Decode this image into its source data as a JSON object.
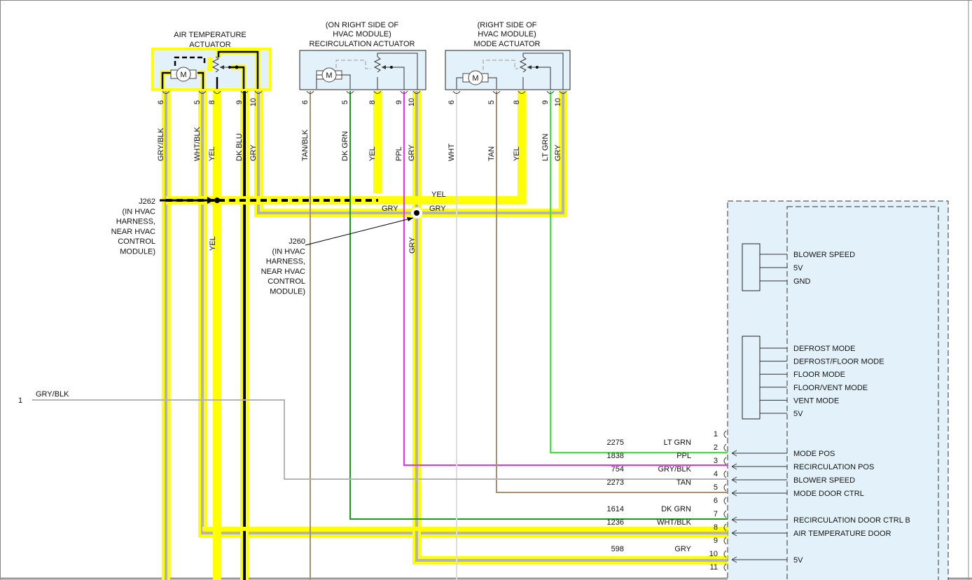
{
  "actuators": {
    "air_temp": {
      "title_1": "AIR TEMPERATURE",
      "title_2": "ACTUATOR",
      "pins": [
        "6",
        "5",
        "8",
        "9",
        "10"
      ],
      "wires": [
        "GRY/BLK",
        "WHT/BLK",
        "YEL",
        "DK BLU",
        "GRY"
      ]
    },
    "recirc": {
      "title_1": "(ON RIGHT SIDE OF",
      "title_2": "HVAC MODULE)",
      "title_3": "RECIRCULATION ACTUATOR",
      "pins": [
        "6",
        "5",
        "8",
        "9",
        "10"
      ],
      "wires": [
        "TAN/BLK",
        "DK GRN",
        "YEL",
        "PPL",
        "GRY"
      ]
    },
    "mode": {
      "title_1": "(RIGHT SIDE OF",
      "title_2": "HVAC MODULE)",
      "title_3": "MODE ACTUATOR",
      "pins": [
        "6",
        "5",
        "8",
        "9",
        "10"
      ],
      "wires": [
        "WHT",
        "TAN",
        "YEL",
        "LT GRN",
        "GRY"
      ]
    },
    "motor_symbol": "M"
  },
  "splices": {
    "j262": {
      "lines": [
        "J262",
        "(IN HVAC",
        "HARNESS,",
        "NEAR HVAC",
        "CONTROL",
        "MODULE)"
      ]
    },
    "j260": {
      "lines": [
        "J260",
        "(IN HVAC",
        "HARNESS,",
        "NEAR HVAC",
        "CONTROL",
        "MODULE)"
      ]
    },
    "labels": {
      "yel_top": "YEL",
      "gry_left": "GRY",
      "gry_right": "GRY",
      "yel_down": "YEL",
      "gry_down": "GRY"
    }
  },
  "left_connector": {
    "pin": "1",
    "wire": "GRY/BLK"
  },
  "module": {
    "blower_group": [
      "BLOWER SPEED",
      "5V",
      "GND"
    ],
    "mode_group": [
      "DEFROST MODE",
      "DEFROST/FLOOR MODE",
      "FLOOR MODE",
      "FLOOR/VENT MODE",
      "VENT MODE",
      "5V"
    ],
    "pins": [
      {
        "pin": "1",
        "circuit": "",
        "wire": "",
        "func": ""
      },
      {
        "pin": "2",
        "circuit": "2275",
        "wire": "LT GRN",
        "func": "MODE POS"
      },
      {
        "pin": "3",
        "circuit": "1838",
        "wire": "PPL",
        "func": "RECIRCULATION POS"
      },
      {
        "pin": "4",
        "circuit": "754",
        "wire": "GRY/BLK",
        "func": "BLOWER SPEED"
      },
      {
        "pin": "5",
        "circuit": "2273",
        "wire": "TAN",
        "func": "MODE DOOR CTRL"
      },
      {
        "pin": "6",
        "circuit": "",
        "wire": "",
        "func": ""
      },
      {
        "pin": "7",
        "circuit": "1614",
        "wire": "DK GRN",
        "func": "RECIRCULATION DOOR CTRL B"
      },
      {
        "pin": "8",
        "circuit": "1236",
        "wire": "WHT/BLK",
        "func": "AIR TEMPERATURE DOOR"
      },
      {
        "pin": "9",
        "circuit": "",
        "wire": "",
        "func": ""
      },
      {
        "pin": "10",
        "circuit": "598",
        "wire": "GRY",
        "func": "5V"
      },
      {
        "pin": "11",
        "circuit": "",
        "wire": "",
        "func": ""
      }
    ]
  },
  "colors": {
    "yellow": "#ffff00",
    "gray": "#b4b4b4",
    "black": "#000000",
    "dk_grn": "#1f9a1f",
    "lt_grn": "#33ee33",
    "ppl": "#ff22ff",
    "tan": "#a89070",
    "wht": "#dddddd",
    "box": "#e3f2fa"
  }
}
